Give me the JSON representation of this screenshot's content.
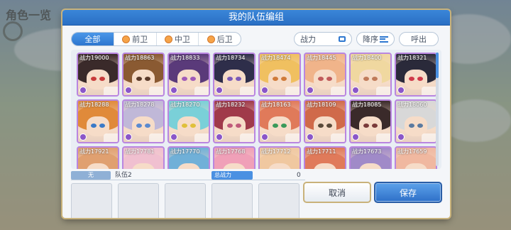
{
  "background": {
    "title": "角色一览"
  },
  "modal": {
    "title": "我的队伍编组"
  },
  "filters": {
    "tabs": [
      {
        "label": "全部",
        "active": true,
        "icon": ""
      },
      {
        "label": "前卫",
        "active": false,
        "icon": "front-position-icon"
      },
      {
        "label": "中卫",
        "active": false,
        "icon": "middle-position-icon"
      },
      {
        "label": "后卫",
        "active": false,
        "icon": "rear-position-icon"
      }
    ],
    "sort_field_label": "战力",
    "sort_order_label": "降序",
    "callout_label": "呼出"
  },
  "characters": [
    {
      "power": "战力19000",
      "hair": "#3a2a2a",
      "eye": "#c83a3a"
    },
    {
      "power": "战力18863",
      "hair": "#8a5a32",
      "eye": "#5a3a2a"
    },
    {
      "power": "战力18833",
      "hair": "#5a3a7a",
      "eye": "#a05ab8"
    },
    {
      "power": "战力18734",
      "hair": "#2e2e4a",
      "eye": "#7a5ab8"
    },
    {
      "power": "战力18474",
      "hair": "#f0c060",
      "eye": "#d07a3a"
    },
    {
      "power": "战力18445",
      "hair": "#f0b48a",
      "eye": "#c05a5a"
    },
    {
      "power": "战力18400",
      "hair": "#f0d8a0",
      "eye": "#c07a5a"
    },
    {
      "power": "战力18321",
      "hair": "#2a2a3a",
      "eye": "#d03a4a"
    },
    {
      "power": "战力18288",
      "hair": "#e08a3a",
      "eye": "#3a7ac8"
    },
    {
      "power": "战力18278",
      "hair": "#c0b8d8",
      "eye": "#5a8ad0"
    },
    {
      "power": "战力18270",
      "hair": "#7ad0d8",
      "eye": "#e0c03a"
    },
    {
      "power": "战力18232",
      "hair": "#a03a4a",
      "eye": "#c05a7a"
    },
    {
      "power": "战力18163",
      "hair": "#e07a5a",
      "eye": "#3a9a5a"
    },
    {
      "power": "战力18109",
      "hair": "#d06a4a",
      "eye": "#5a4a3a"
    },
    {
      "power": "战力18085",
      "hair": "#3a2a2a",
      "eye": "#7a3a3a"
    },
    {
      "power": "战力18060",
      "hair": "#d8d8d8",
      "eye": "#5a7aa0"
    },
    {
      "power": "战力17921",
      "hair": "#e0a070",
      "eye": "#7a5a3a"
    },
    {
      "power": "战力17781",
      "hair": "#f0c0d0",
      "eye": "#c05a7a"
    },
    {
      "power": "战力17770",
      "hair": "#70b0d8",
      "eye": "#3a5a8a"
    },
    {
      "power": "战力17768",
      "hair": "#f0a0b8",
      "eye": "#c05a7a"
    },
    {
      "power": "战力17712",
      "hair": "#f0c8a0",
      "eye": "#a05a3a"
    },
    {
      "power": "战力17711",
      "hair": "#e07a5a",
      "eye": "#5a3a2a"
    },
    {
      "power": "战力17673",
      "hair": "#a08ac8",
      "eye": "#5a4a8a"
    },
    {
      "power": "战力17659",
      "hair": "#f0b8a0",
      "eye": "#c07a5a"
    }
  ],
  "team": {
    "none_label": "无",
    "name": "队伍2",
    "total_power_label": "总战力",
    "total_power_value": "0"
  },
  "buttons": {
    "cancel": "取消",
    "save": "保存"
  },
  "colors": {
    "accent": "#2e6fc8",
    "frame_gold": "#c9b27a",
    "card_border": "#b986e0"
  }
}
